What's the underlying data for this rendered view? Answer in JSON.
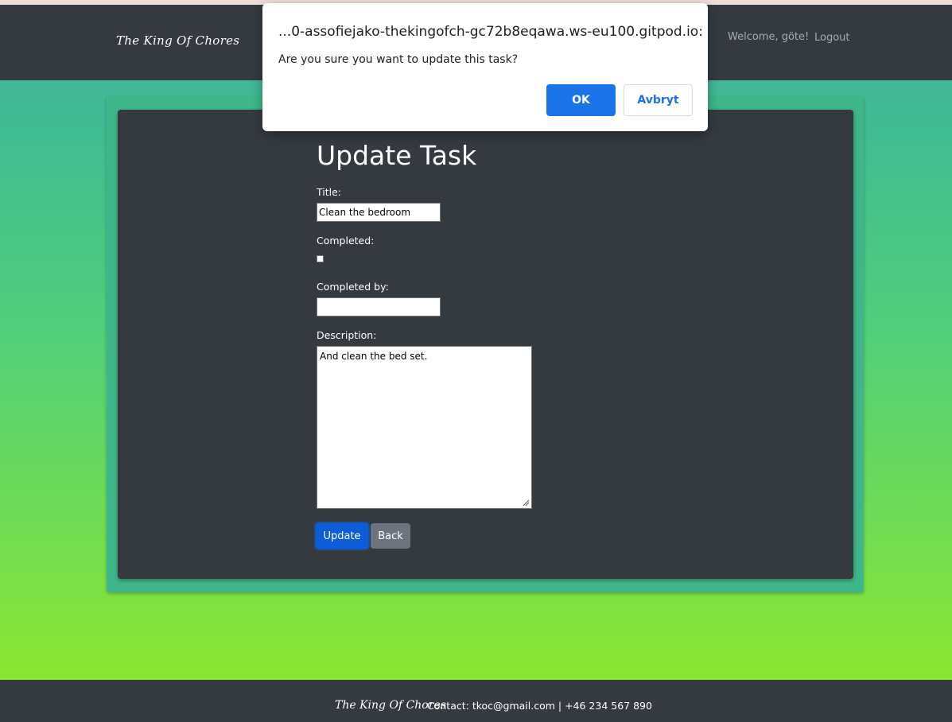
{
  "navbar": {
    "brand": "The King Of Chores",
    "welcome": "Welcome, göte!",
    "logout": "Logout"
  },
  "form": {
    "title": "Update Task",
    "title_label": "Title:",
    "title_value": "Clean the bedroom",
    "completed_label": "Completed:",
    "completed_checked": false,
    "completed_by_label": "Completed by:",
    "completed_by_value": "",
    "description_label": "Description:",
    "description_value": "And clean the bed set.",
    "update_button": "Update",
    "back_button": "Back"
  },
  "footer": {
    "brand": "The King Of Chores",
    "contact": "Contact: tkoc@gmail.com | +46 234 567 890"
  },
  "dialog": {
    "origin": "...0-assofiejako-thekingofch-gc72b8eqawa.ws-eu100.gitpod.io:",
    "message": "Are you sure you want to update this task?",
    "ok": "OK",
    "cancel": "Avbryt"
  },
  "colors": {
    "navbar_bg": "#343a40",
    "primary": "#0b5ed7",
    "secondary": "#6c757d",
    "dialog_accent": "#1a73e8"
  }
}
